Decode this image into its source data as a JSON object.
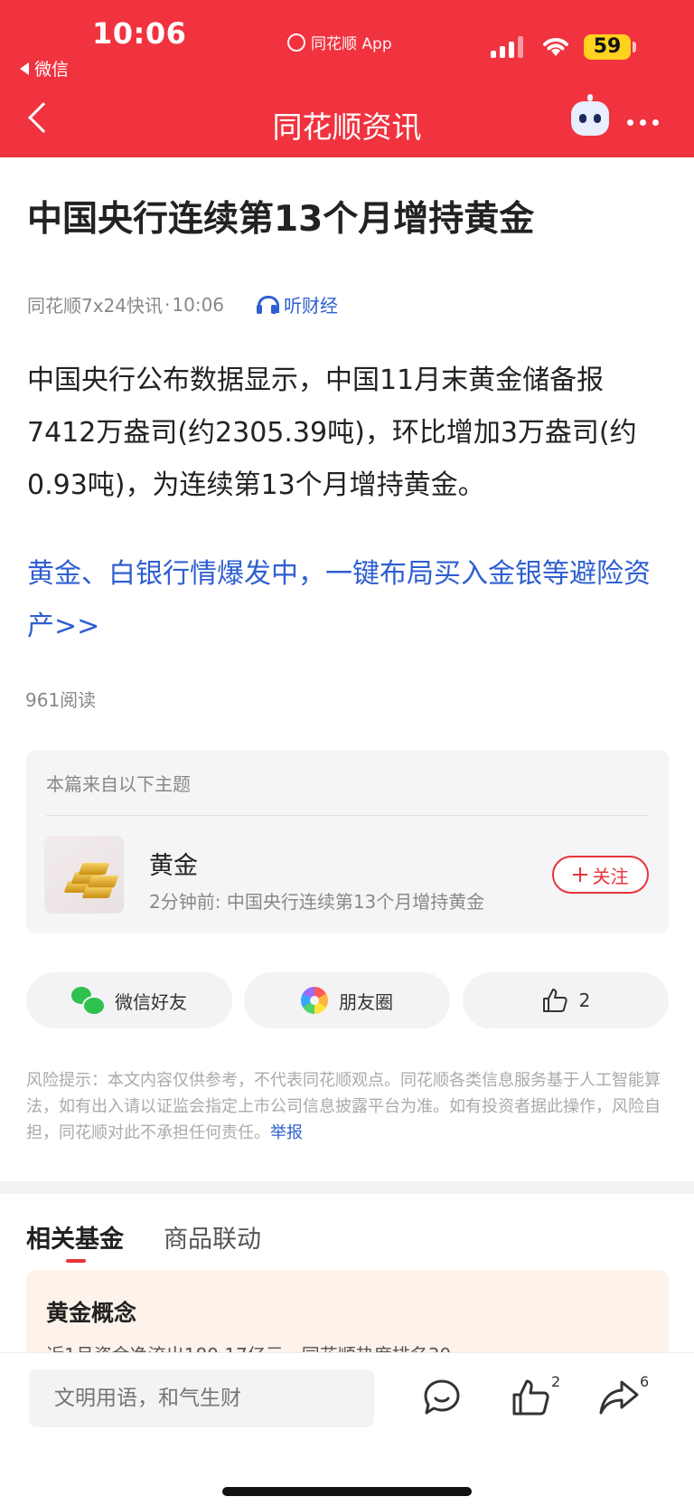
{
  "status_bar": {
    "time": "10:06",
    "back_app": "微信",
    "center_app": "同花顺 App",
    "battery": "59"
  },
  "nav": {
    "title": "同花顺资讯",
    "icons": [
      "back-chevron-icon",
      "robot-assistant-icon",
      "more-icon"
    ]
  },
  "article": {
    "title": "中国央行连续第13个月增持黄金",
    "source": "同花顺7x24快讯",
    "separator": "·",
    "time": "10:06",
    "listen_label": "听财经",
    "body": "中国央行公布数据显示，中国11月末黄金储备报7412万盎司(约2305.39吨)，环比增加3万盎司(约0.93吨)，为连续第13个月增持黄金。",
    "promo": "黄金、白银行情爆发中，一键布局买入金银等避险资产>>",
    "reads": "961阅读"
  },
  "topic": {
    "header": "本篇来自以下主题",
    "name": "黄金",
    "subtitle": "2分钟前: 中国央行连续第13个月增持黄金",
    "follow_label": "关注"
  },
  "share": {
    "wechat_label": "微信好友",
    "moments_label": "朋友圈",
    "like_count": "2"
  },
  "risk": {
    "text": "风险提示：本文内容仅供参考，不代表同花顺观点。同花顺各类信息服务基于人工智能算法，如有出入请以证监会指定上市公司信息披露平台为准。如有投资者据此操作，风险自担，同花顺对此不承担任何责任。",
    "report_label": "举报"
  },
  "tabs": [
    {
      "label": "相关基金",
      "active": true
    },
    {
      "label": "商品联动",
      "active": false
    }
  ],
  "fund_card": {
    "title": "黄金概念",
    "subtitle": "近1月资金净流出180.17亿元，同花顺热度排名30"
  },
  "bottom_bar": {
    "comment_placeholder": "文明用语，和气生财",
    "like_count": "2",
    "share_count": "6"
  },
  "colors": {
    "brand_red": "#f0333f",
    "link_blue": "#2f5fd0",
    "accent_red": "#e8343a"
  }
}
